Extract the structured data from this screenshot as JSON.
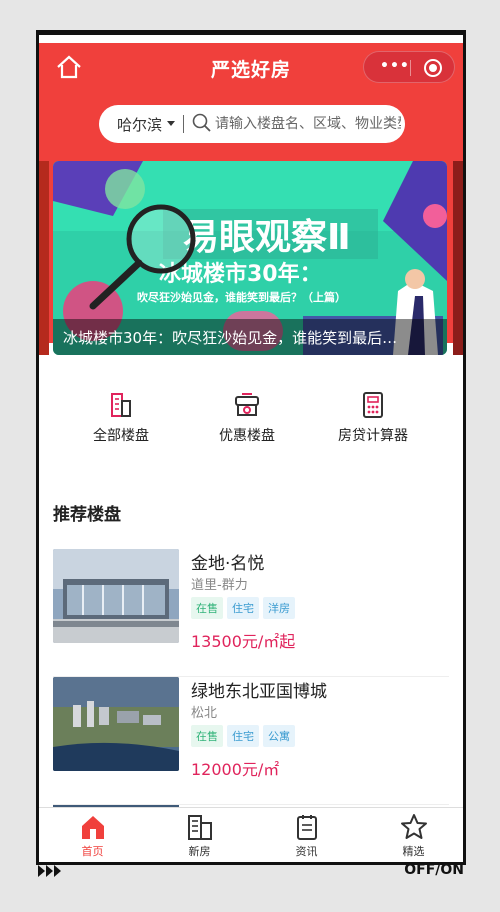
{
  "nav": {
    "title": "严选好房"
  },
  "search": {
    "city": "哈尔滨",
    "placeholder": "请输入楼盘名、区域、物业类型"
  },
  "banner": {
    "headline": "易眼观察Ⅱ",
    "subhead": "冰城楼市30年：",
    "tagline": "吹尽狂沙始见金，谁能笑到最后？（上篇）",
    "caption": "冰城楼市30年：吹尽狂沙始见金，谁能笑到最后…"
  },
  "entries": [
    {
      "label": "全部楼盘",
      "icon": "building-icon"
    },
    {
      "label": "优惠楼盘",
      "icon": "discount-icon"
    },
    {
      "label": "房贷计算器",
      "icon": "calculator-icon"
    }
  ],
  "section": {
    "title": "推荐楼盘"
  },
  "listings": [
    {
      "name": "金地·名悦",
      "area": "道里-群力",
      "tags": [
        "在售",
        "住宅",
        "洋房"
      ],
      "price": "13500元/㎡起"
    },
    {
      "name": "绿地东北亚国博城",
      "area": "松北",
      "tags": [
        "在售",
        "住宅",
        "公寓"
      ],
      "price": "12000元/㎡"
    }
  ],
  "tabs": [
    {
      "label": "首页",
      "icon": "home-icon",
      "active": true
    },
    {
      "label": "新房",
      "icon": "new-house-icon"
    },
    {
      "label": "资讯",
      "icon": "news-icon"
    },
    {
      "label": "精选",
      "icon": "star-icon"
    }
  ],
  "footer": {
    "toggle": "OFF/ON"
  },
  "colors": {
    "brand": "#f0403c",
    "price": "#e0245c"
  }
}
